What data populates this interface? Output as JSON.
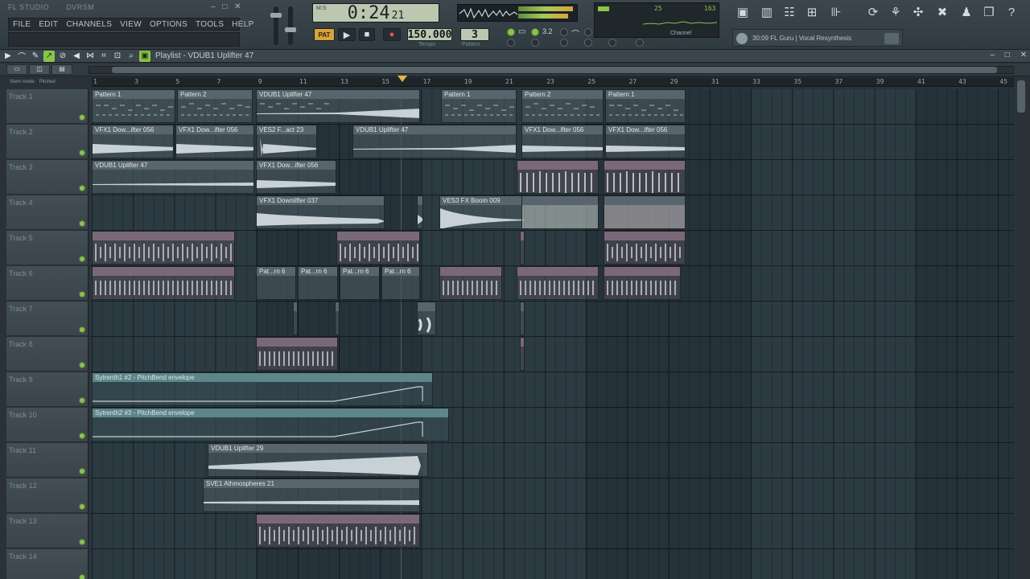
{
  "window": {
    "title_left": "FL STUDIO",
    "project": "DVRSM",
    "controls": [
      "–",
      "□",
      "✕"
    ]
  },
  "menu": [
    "FILE",
    "EDIT",
    "CHANNELS",
    "VIEW",
    "OPTIONS",
    "TOOLS",
    "HELP"
  ],
  "transport": {
    "time_main": "0:24",
    "time_sub": "21",
    "time_mode": "M:S",
    "pattern_label": "PAT",
    "tempo": "150.000",
    "tempo_label": "Tempo",
    "pattern_number": "3",
    "pattern_num_label": "Pattern"
  },
  "snap": {
    "value": "3.2"
  },
  "cpu": {
    "cpu_value": "25",
    "mem_value": "163",
    "label": "Channel"
  },
  "hint": {
    "text": "30:09 FL Guru | Vocal Resynthesis"
  },
  "playlist": {
    "title": "Playlist - VDUB1 Uplifter 47",
    "tools": [
      "▶",
      "⌒",
      "✎",
      "↗",
      "⊘",
      "◀",
      "⋈",
      "⌗",
      "⊡",
      "⌕",
      "▣"
    ],
    "tabs": [
      "▭",
      "◫",
      "▤"
    ],
    "options": [
      "Stem mode",
      "Pitched"
    ]
  },
  "ruler": {
    "bars": [
      "1",
      "3",
      "5",
      "7",
      "9",
      "11",
      "13",
      "15",
      "17",
      "19",
      "21",
      "23",
      "25",
      "27",
      "29",
      "31",
      "33",
      "35",
      "37",
      "39",
      "41",
      "43",
      "45"
    ]
  },
  "tracks": [
    {
      "name": "Track 1"
    },
    {
      "name": "Track 2"
    },
    {
      "name": "Track 3"
    },
    {
      "name": "Track 4"
    },
    {
      "name": "Track 5"
    },
    {
      "name": "Track 6"
    },
    {
      "name": "Track 7"
    },
    {
      "name": "Track 8"
    },
    {
      "name": "Track 9"
    },
    {
      "name": "Track 10"
    },
    {
      "name": "Track 11"
    },
    {
      "name": "Track 12"
    },
    {
      "name": "Track 13"
    },
    {
      "name": "Track 14"
    }
  ],
  "clips": {
    "t1": [
      "Pattern 1",
      "Pattern 2",
      "VDUB1 Uplifter 47",
      "Pattern 1",
      "Pattern 2",
      "Pattern 1"
    ],
    "t2": [
      "VFX1 Dow...ifter 056",
      "VFX1 Dow...ifter 056",
      "VES2 F...act 23",
      "VDUB1 Uplifter 47",
      "VFX1 Dow...ifter 056",
      "VFX1 Dow...ifter 056"
    ],
    "t3": [
      "VDUB1 Uplifter 47",
      "VFX1 Dow...ifter 056"
    ],
    "t4": [
      "VFX1 Downlifter 037",
      "VES3 FX Boom 009"
    ],
    "t6": [
      "Pat...rn 6",
      "Pat...rn 6",
      "Pat...rn 6",
      "Pat...rn 6"
    ],
    "t9": [
      "Sytrenth1 #2 - PitchBend envelope"
    ],
    "t10": [
      "Sytrenth2 #3 - PitchBend envelope"
    ],
    "t11": [
      "VDUB1 Uplifter 29"
    ],
    "t12": [
      "SVE1 Athmospheres 21"
    ]
  },
  "colors": {
    "accent_green": "#8ac34a",
    "accent_orange": "#d9a33b",
    "lcd": "#bcc7b0",
    "grid_bg": "#2c3a42"
  },
  "icons": {
    "toolbar_right": [
      "camera-icon",
      "piano-icon",
      "mixer-icon",
      "browser-icon",
      "plugin-icon",
      "reset-icon",
      "magnet-icon",
      "share-icon",
      "eject-icon",
      "mic-icon",
      "save-icon",
      "help-icon"
    ]
  }
}
